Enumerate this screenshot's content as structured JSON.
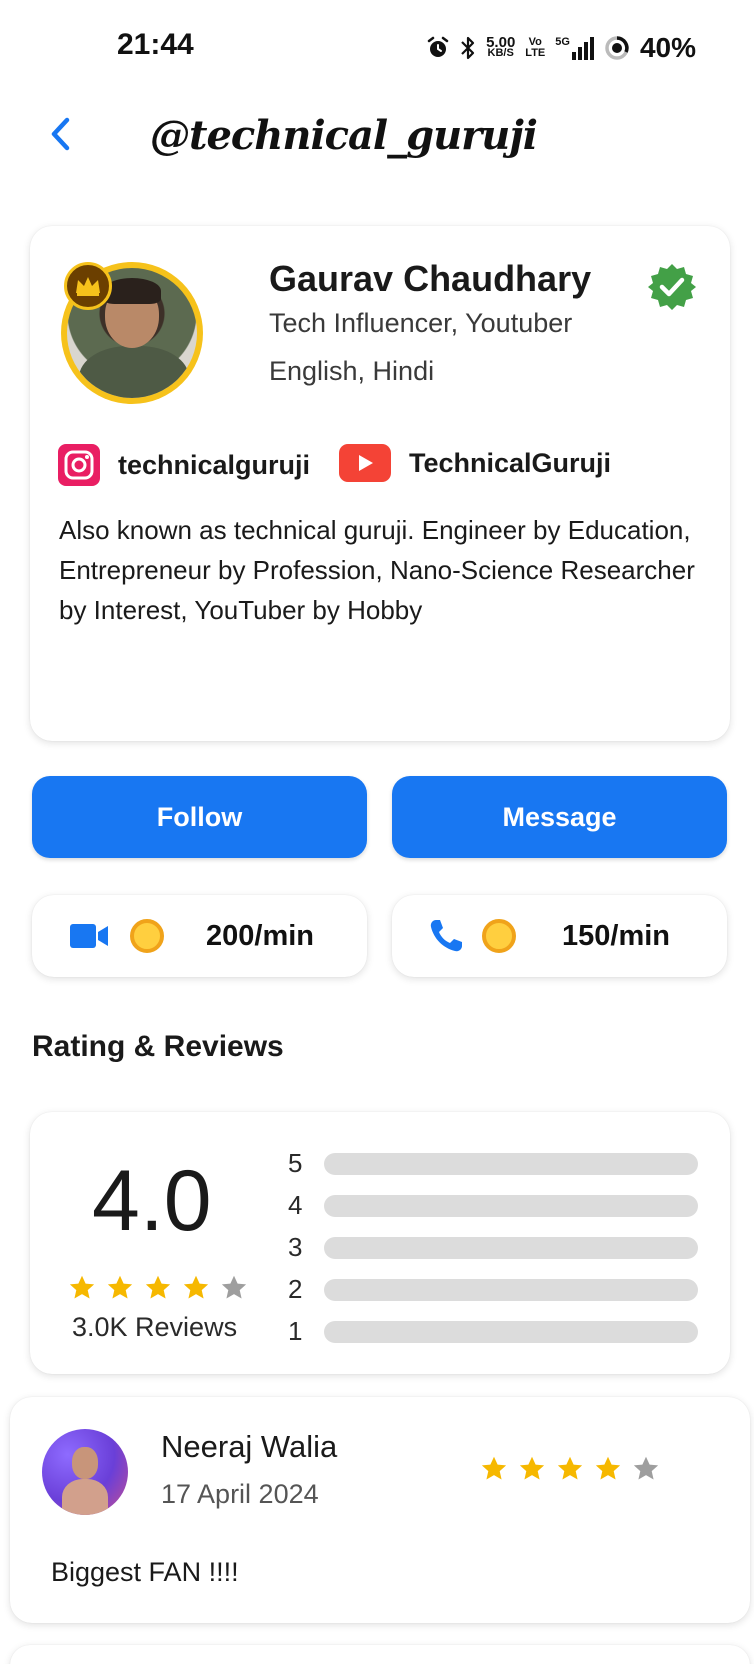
{
  "status_bar": {
    "time": "21:44",
    "net_speed_top": "5.00",
    "net_speed_bottom": "KB/S",
    "volte_top": "Vo",
    "volte_bottom": "LTE",
    "network": "5G",
    "battery": "40%",
    "icons": [
      "alarm-icon",
      "bluetooth-icon",
      "signal-icon",
      "battery-ring-icon"
    ]
  },
  "header": {
    "handle": "@technical_guruji",
    "back_icon": "chevron-left-icon"
  },
  "profile": {
    "name": "Gaurav Chaudhary",
    "title": "Tech Influencer, Youtuber",
    "languages": "English, Hindi",
    "verified_icon": "verified-badge-icon",
    "crown_icon": "crown-icon",
    "instagram": "technicalguruji",
    "youtube": "TechnicalGuruji",
    "bio": "Also known as technical guruji. Engineer by Education, Entrepreneur by Profession, Nano-Science Researcher by Interest, YouTuber by Hobby"
  },
  "actions": {
    "follow": "Follow",
    "message": "Message"
  },
  "rates": {
    "video": "200/min",
    "call": "150/min",
    "video_icon": "video-camera-icon",
    "call_icon": "phone-icon",
    "coin_icon": "coin-icon"
  },
  "ratings": {
    "section_title": "Rating & Reviews",
    "average": "4.0",
    "stars_filled": 4,
    "stars_total": 5,
    "review_count": "3.0K Reviews",
    "levels": [
      "5",
      "4",
      "3",
      "2",
      "1"
    ],
    "level_fill": [
      0,
      0,
      0,
      0,
      0
    ]
  },
  "reviews": [
    {
      "name": "Neeraj Walia",
      "date": "17 April 2024",
      "stars_filled": 4,
      "text": "Biggest FAN !!!!"
    }
  ],
  "colors": {
    "primary": "#1877f2",
    "star": "#f6b800",
    "star_empty": "#9e9e9e",
    "verified": "#43a047",
    "youtube": "#f44336",
    "instagram": "#e91e63"
  }
}
